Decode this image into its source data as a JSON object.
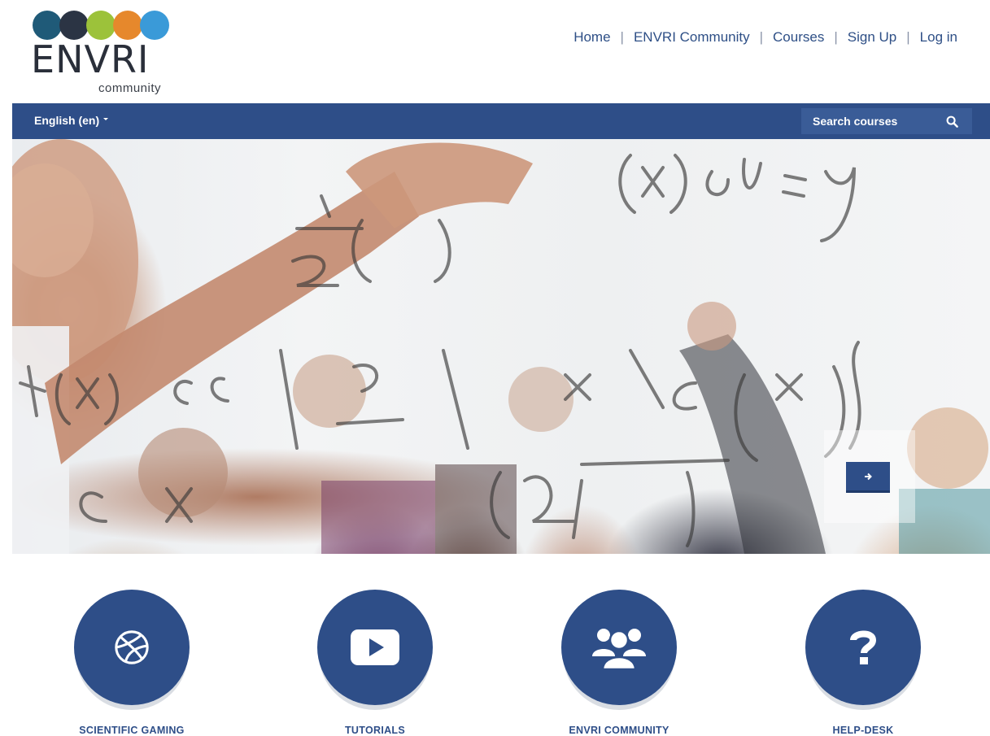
{
  "logo": {
    "word": "ENVRI",
    "sub": "community",
    "dot_colors": [
      "#1f5a78",
      "#2b3444",
      "#9cc23a",
      "#e6882c",
      "#3a9ad8"
    ]
  },
  "topnav": {
    "items": [
      {
        "label": "Home"
      },
      {
        "label": "ENVRI Community"
      },
      {
        "label": "Courses"
      },
      {
        "label": "Sign Up"
      },
      {
        "label": "Log in"
      }
    ]
  },
  "navbar": {
    "language": "English (en)",
    "search_placeholder": "Search courses",
    "search_icon": "search-icon"
  },
  "hero": {
    "next_icon": "arrow-right-icon"
  },
  "features": [
    {
      "label": "SCIENTIFIC GAMING",
      "icon": "basketball-icon"
    },
    {
      "label": "TUTORIALS",
      "icon": "play-icon"
    },
    {
      "label": "ENVRI COMMUNITY",
      "icon": "users-icon"
    },
    {
      "label": "HELP-DESK",
      "icon": "question-icon"
    }
  ],
  "colors": {
    "brand_blue": "#2e4e88",
    "link_blue": "#2e4f86"
  }
}
